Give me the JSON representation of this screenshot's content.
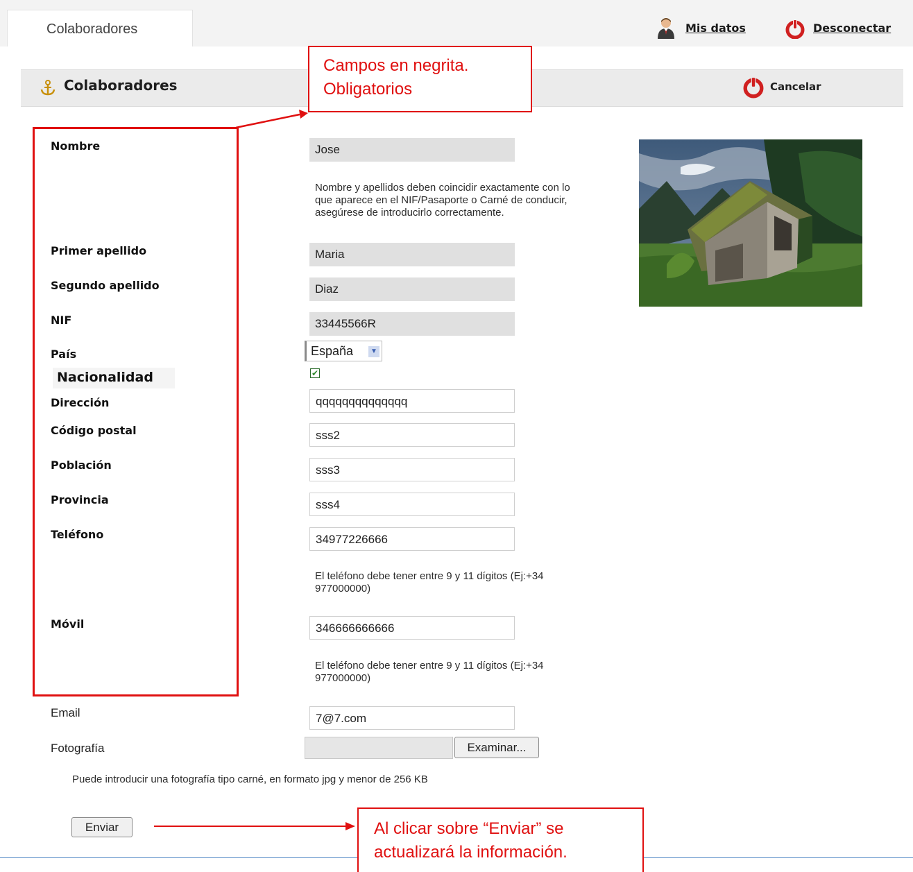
{
  "topbar": {
    "tab_label": "Colaboradores",
    "mis_datos_label": "Mis datos",
    "desconectar_label": "Desconectar"
  },
  "section": {
    "title": "Colaboradores",
    "cancel_label": "Cancelar"
  },
  "form": {
    "nombre": {
      "label": "Nombre",
      "value": "Jose",
      "help": [
        "Nombre y apellidos deben coincidir exactamente con lo",
        "que aparece en el NIF/Pasaporte o Carné de conducir,",
        "asegúrese de introducirlo correctamente."
      ]
    },
    "primer_apellido": {
      "label": "Primer apellido",
      "value": "Maria"
    },
    "segundo_apellido": {
      "label": "Segundo apellido",
      "value": "Diaz"
    },
    "nif": {
      "label": "NIF",
      "value": "33445566R"
    },
    "pais": {
      "label": "País",
      "value": "España"
    },
    "nacionalidad": {
      "label": "Nacionalidad",
      "checked": true
    },
    "direccion": {
      "label": "Dirección",
      "value": "qqqqqqqqqqqqqq"
    },
    "codigo_postal": {
      "label": "Código postal",
      "value": "sss2"
    },
    "poblacion": {
      "label": "Población",
      "value": "sss3"
    },
    "provincia": {
      "label": "Provincia",
      "value": "sss4"
    },
    "telefono": {
      "label": "Teléfono",
      "value": "34977226666",
      "help": [
        "El teléfono debe tener entre 9 y 11 dígitos (Ej:+34",
        "977000000)"
      ]
    },
    "movil": {
      "label": "Móvil",
      "value": "346666666666",
      "help": [
        "El teléfono debe tener entre 9 y 11 dígitos (Ej:+34",
        "977000000)"
      ]
    },
    "email": {
      "label": "Email",
      "value": "7@7.com"
    },
    "fotografia": {
      "label": "Fotografía",
      "browse_label": "Examinar...",
      "help": "Puede introducir una fotografía tipo carné, en formato jpg y menor de 256 KB"
    },
    "submit_label": "Enviar"
  },
  "annotations": {
    "required_note": [
      "Campos en negrita.",
      "Obligatorios"
    ],
    "submit_note": [
      "Al clicar sobre “Enviar” se",
      "actualizará la información."
    ]
  },
  "colors": {
    "callout_red": "#e01010",
    "readonly_bg": "#e0e0e0",
    "header_bg": "#ebebeb"
  }
}
